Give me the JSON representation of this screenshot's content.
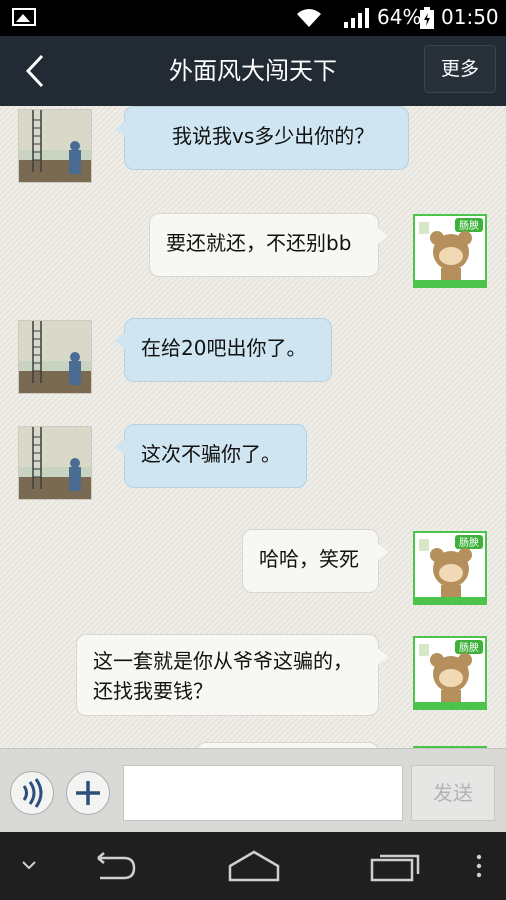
{
  "status_bar": {
    "battery_percent": "64%",
    "time": "01:50",
    "icons": [
      "image-icon",
      "wifi-icon",
      "signal-icon",
      "battery-charging-icon"
    ]
  },
  "header": {
    "title": "外面风大闯天下",
    "more_label": "更多",
    "background": "#222b34"
  },
  "messages": [
    {
      "side": "left",
      "text": "我说我vs多少出你的？"
    },
    {
      "side": "right",
      "text": "要还就还，不还别bb"
    },
    {
      "side": "left",
      "text": "在给20吧出你了。"
    },
    {
      "side": "left",
      "text": "这次不骗你了。"
    },
    {
      "side": "right",
      "text": "哈哈，笑死"
    },
    {
      "side": "right",
      "text": "这一套就是你从爷爷这骗的，还找我要钱？"
    }
  ],
  "composer": {
    "input_value": "",
    "send_label": "发送"
  },
  "colors": {
    "incoming_bubble": "#cfe5f2",
    "outgoing_bubble": "#f7f7f4",
    "chat_background": "#ebe8e1"
  }
}
